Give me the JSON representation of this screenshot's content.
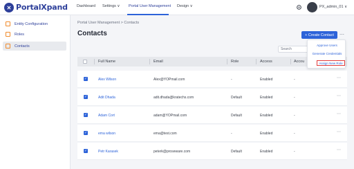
{
  "app": {
    "logo_text": "PortalXpand",
    "logo_mark": "✕"
  },
  "topnav": {
    "items": [
      "Dashboard",
      "Settings ∨",
      "Portal User Management",
      "Design ∨"
    ],
    "user_name": "PX_admin_01 ∨",
    "settings_icon": "gear-icon",
    "avatar_icon": "user-avatar-icon"
  },
  "sidebar": {
    "items": [
      {
        "label": "Entity Configuration",
        "icon": "entity-icon"
      },
      {
        "label": "Roles",
        "icon": "roles-icon"
      },
      {
        "label": "Contacts",
        "icon": "contacts-icon"
      }
    ]
  },
  "page": {
    "breadcrumb": "Portal User Management  >  Contacts",
    "title": "Contacts",
    "create_button": "+ Create Contact",
    "more": "⋯",
    "search_placeholder": "Search"
  },
  "menu": {
    "items": [
      "Approve Users",
      "Generate Credentials",
      "Assign New Role"
    ]
  },
  "table": {
    "columns": [
      "Full Name",
      "Email",
      "Role",
      "Access",
      "Accou"
    ],
    "rows": [
      {
        "name": "Alex Wilson",
        "email": "Alex@YOPmail.com",
        "role": "-",
        "access": "Enabled",
        "account": "-"
      },
      {
        "name": "Adit Dhada",
        "email": "adit.dhada@kratechs.com",
        "role": "Default",
        "access": "Enabled",
        "account": "-"
      },
      {
        "name": "Adam Cort",
        "email": "adam@YOPmail.com",
        "role": "Default",
        "access": "Enabled",
        "account": "-"
      },
      {
        "name": "ema wilson",
        "email": "ema@test.com",
        "role": "-",
        "access": "Enabled",
        "account": "-"
      },
      {
        "name": "Petr Karasek",
        "email": "peterk@proseware.com",
        "role": "Default",
        "access": "Enabled",
        "account": "-"
      }
    ],
    "row_more": "⋯"
  },
  "colors": {
    "accent": "#2d63d9",
    "brand": "#2d3f9a",
    "highlight": "#e23c3c",
    "sidebar_icon": "#f08a2a"
  }
}
